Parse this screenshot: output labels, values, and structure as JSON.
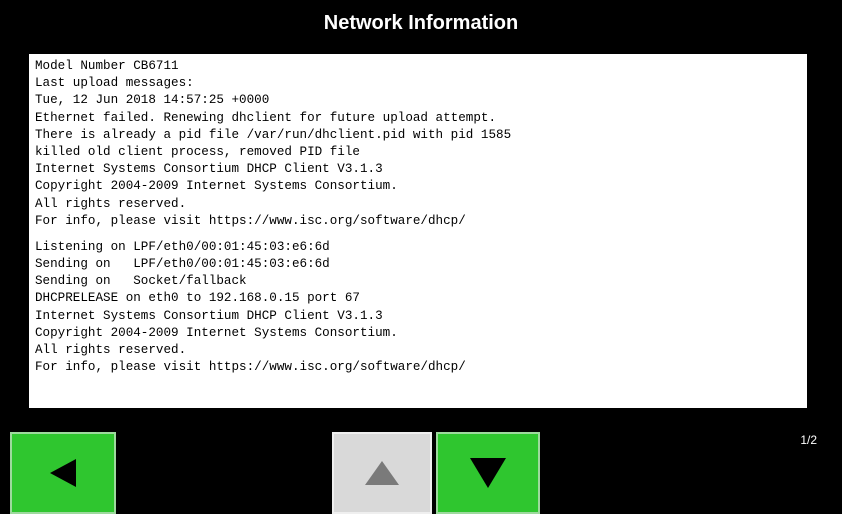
{
  "header": {
    "title": "Network Information"
  },
  "log": {
    "block1": [
      "Model Number CB6711",
      "Last upload messages:",
      "Tue, 12 Jun 2018 14:57:25 +0000",
      "Ethernet failed. Renewing dhclient for future upload attempt.",
      "There is already a pid file /var/run/dhclient.pid with pid 1585",
      "killed old client process, removed PID file",
      "Internet Systems Consortium DHCP Client V3.1.3",
      "Copyright 2004-2009 Internet Systems Consortium.",
      "All rights reserved.",
      "For info, please visit https://www.isc.org/software/dhcp/"
    ],
    "block2": [
      "Listening on LPF/eth0/00:01:45:03:e6:6d",
      "Sending on   LPF/eth0/00:01:45:03:e6:6d",
      "Sending on   Socket/fallback",
      "DHCPRELEASE on eth0 to 192.168.0.15 port 67",
      "Internet Systems Consortium DHCP Client V3.1.3",
      "Copyright 2004-2009 Internet Systems Consortium.",
      "All rights reserved.",
      "For info, please visit https://www.isc.org/software/dhcp/"
    ]
  },
  "nav": {
    "back_icon": "left-arrow-icon",
    "up_icon": "up-arrow-icon",
    "down_icon": "down-arrow-icon",
    "up_enabled": false,
    "down_enabled": true,
    "page_indicator": "1/2"
  },
  "colors": {
    "background": "#000000",
    "button_active": "#2fc62f",
    "button_disabled": "#d9d9d9",
    "panel": "#ffffff"
  }
}
